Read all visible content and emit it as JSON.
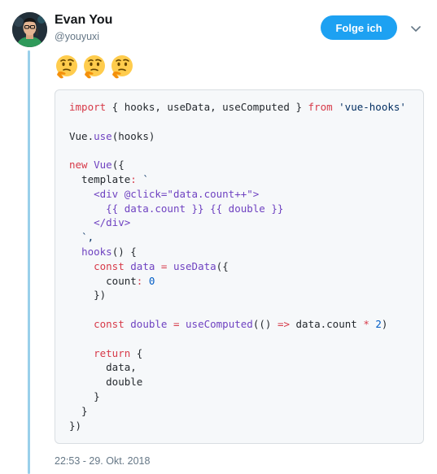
{
  "tweet": {
    "author_name": "Evan You",
    "author_handle": "@youyuxi",
    "follow_label": "Folge ich",
    "emojis": [
      "thinking-face",
      "thinking-face",
      "thinking-face"
    ],
    "timestamp": "22:53 - 29. Okt. 2018"
  },
  "code": {
    "lines": [
      "import { hooks, useData, useComputed } from 'vue-hooks'",
      "",
      "Vue.use(hooks)",
      "",
      "new Vue({",
      "  template: `",
      "    <div @click=\"data.count++\">",
      "      {{ data.count }} {{ double }}",
      "    </div>",
      "  `,",
      "  hooks() {",
      "    const data = useData({",
      "      count: 0",
      "    })",
      "",
      "    const double = useComputed(() => data.count * 2)",
      "",
      "    return {",
      "      data,",
      "      double",
      "    }",
      "  }",
      "})"
    ]
  },
  "colors": {
    "accent": "#1da1f2",
    "thread_line": "#9ad0ea",
    "keyword": "#d73a49",
    "function": "#6f42c1",
    "string": "#032f62",
    "number": "#005cc5"
  }
}
